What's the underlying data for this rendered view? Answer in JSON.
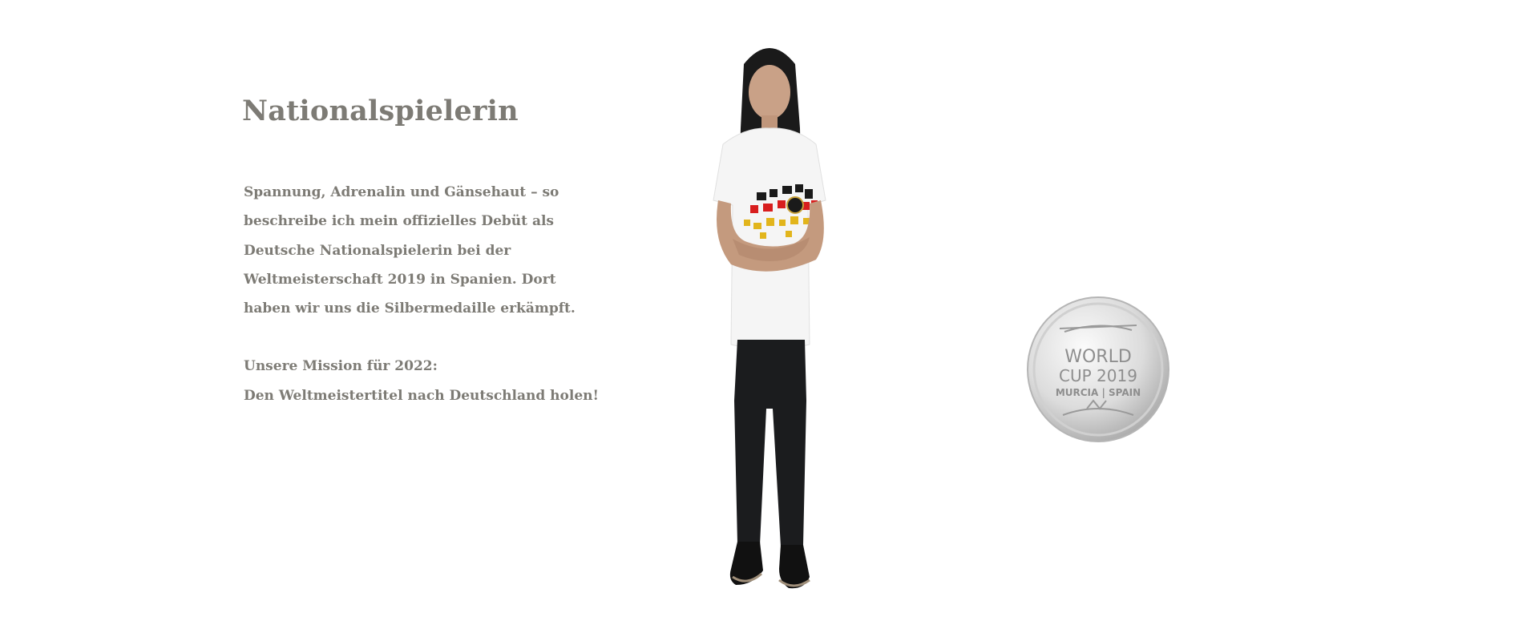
{
  "section": {
    "title": "Nationalspielerin",
    "paragraph1": "Spannung, Adrenalin und Gänsehaut – so\nbeschreibe ich mein offizielles Debüt als\nDeutsche Nationalspielerin bei der\nWeltmeisterschaft 2019 in Spanien. Dort\nhaben wir uns die Silbermedaille erkämpft.",
    "paragraph2": "Unsere Mission für 2022:\nDen Weltmeistertitel nach Deutschland holen!"
  },
  "medal": {
    "line1": "WORLD",
    "line2": "CUP 2019",
    "line3": "MURCIA | SPAIN"
  },
  "colors": {
    "text": "#7d7b75",
    "background": "#ffffff"
  },
  "icons": {
    "player": "player-photo",
    "medal": "silver-medal-icon"
  }
}
